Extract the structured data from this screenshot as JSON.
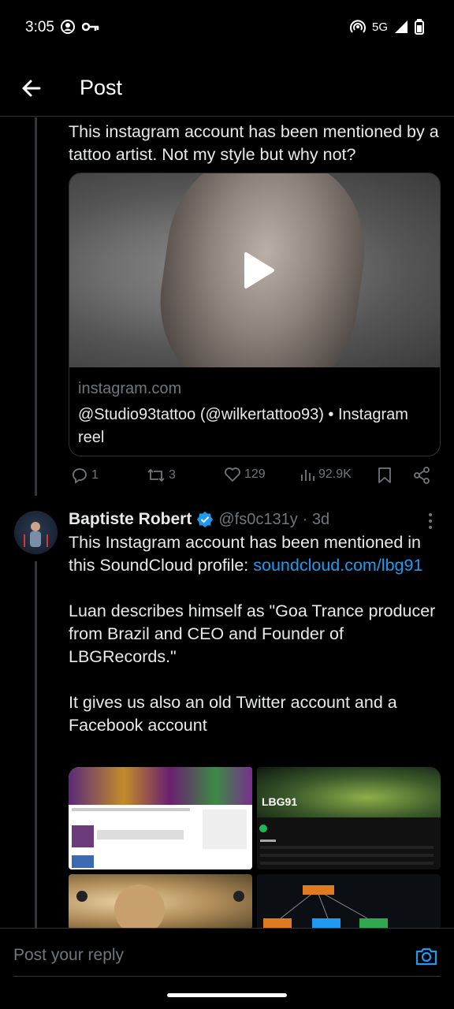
{
  "status_bar": {
    "time": "3:05",
    "network": "5G"
  },
  "header": {
    "title": "Post"
  },
  "first_post": {
    "text": "This instagram account has been mentioned by a tattoo artist. Not my style but why not?",
    "link_card": {
      "domain": "instagram.com",
      "title": "@Studio93tattoo (@wilkertattoo93) • Instagram reel"
    },
    "actions": {
      "replies": "1",
      "reposts": "3",
      "likes": "129",
      "views": "92.9K"
    }
  },
  "second_post": {
    "author_name": "Baptiste Robert",
    "handle": "@fs0c131y",
    "time": "· 3d",
    "text_part1": "This Instagram account has been mentioned in this SoundCloud profile: ",
    "link_text": "soundcloud.com/lbg91",
    "paragraph2": "Luan describes himself as \"Goa Trance producer from Brazil and CEO and Founder of LBGRecords.\"",
    "paragraph3": "It gives us also an old Twitter account and a Facebook account",
    "media_label": "LBG91"
  },
  "reply_bar": {
    "placeholder": "Post your reply"
  },
  "colors": {
    "accent": "#1d9bf0",
    "muted": "#71767b",
    "text": "#e7e9ea"
  }
}
